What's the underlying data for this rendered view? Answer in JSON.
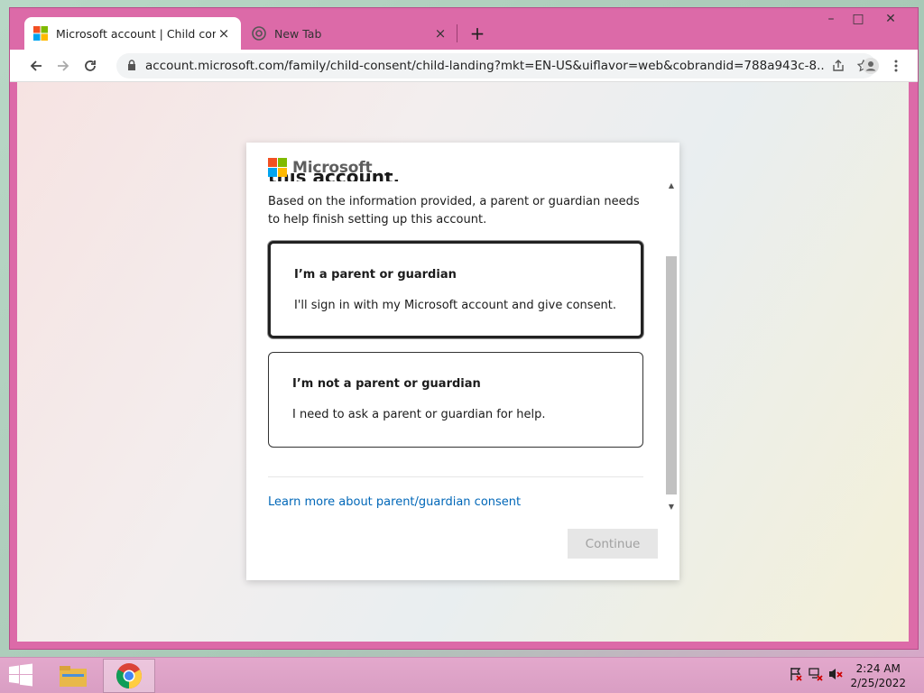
{
  "browser": {
    "tabs": [
      {
        "title": "Microsoft account | Child consent",
        "close": "×"
      },
      {
        "title": "New Tab",
        "close": "×"
      }
    ],
    "new_tab": "+",
    "window_controls": {
      "minimize": "–",
      "maximize": "□",
      "close": "✕"
    },
    "url": "account.microsoft.com/family/child-consent/child-landing?mkt=EN-US&uiflavor=web&cobrandid=788a943c-8..."
  },
  "dialog": {
    "brand": "Microsoft",
    "heading_fragment": "this account.",
    "intro": "Based on the information provided, a parent or guardian needs to help finish setting up this account.",
    "options": [
      {
        "title": "I’m a parent or guardian",
        "description": "I'll sign in with my Microsoft account and give consent."
      },
      {
        "title": "I’m not a parent or guardian",
        "description": "I need to ask a parent or guardian for help."
      }
    ],
    "learn_more": "Learn more about parent/guardian consent",
    "continue": "Continue"
  },
  "taskbar": {
    "time": "2:24 AM",
    "date": "2/25/2022"
  },
  "colors": {
    "accent": "#0067b8",
    "chrome_frame": "#dc6aa8"
  }
}
